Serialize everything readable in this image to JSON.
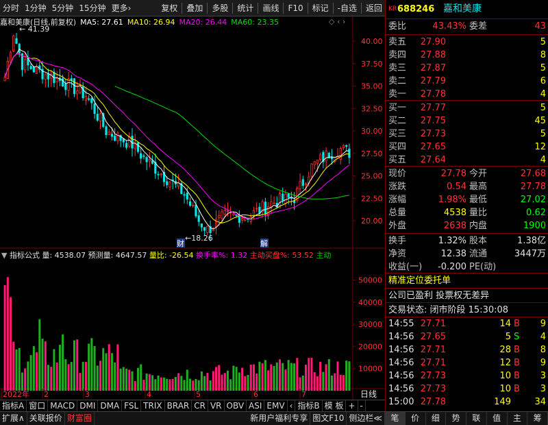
{
  "toolbar": {
    "left": [
      "分时",
      "1分钟",
      "5分钟",
      "15分钟",
      "更多›"
    ],
    "right": [
      "复权",
      "叠加",
      "多股",
      "统计",
      "画线",
      "F10",
      "标记",
      "-自选",
      "返回"
    ]
  },
  "chart": {
    "title": "嘉和美康(日线,前复权)",
    "ma5": "MA5: 27.61",
    "ma10": "MA10: 26.94",
    "ma20": "MA20: 26.44",
    "ma60": "MA60: 23.35",
    "high_label": "41.39",
    "low_label": "18.26",
    "marker_cai": "财",
    "marker_jie": "解",
    "price_ticks": [
      "40.00",
      "37.50",
      "35.00",
      "32.50",
      "30.00",
      "27.50",
      "25.00",
      "22.50",
      "20.00"
    ],
    "price_tick_values": [
      40,
      37.5,
      35,
      32.5,
      30,
      27.5,
      25,
      22.5,
      20
    ],
    "colors": {
      "up": "#ff3232",
      "down": "#00e6e6",
      "ma5": "#ffffff",
      "ma10": "#ffff00",
      "ma20": "#ff00ff",
      "ma60": "#00dd00"
    }
  },
  "indicator": {
    "label": "指标公式",
    "vol": "量: 4538.07",
    "pred": "预测量: 4647.57",
    "liangbi": "量比: -26.54",
    "huanshou": "换手率%: 1.32",
    "zhudong": "主动买盘%: 53.52",
    "zhudong2": "主动",
    "vol_ticks": [
      "50000",
      "40000",
      "30000",
      "20000",
      "10000"
    ],
    "vol_tick_values": [
      50000,
      40000,
      30000,
      20000,
      10000
    ]
  },
  "xaxis": {
    "labels": [
      "2022年",
      "2",
      "3",
      "4",
      "5",
      "6",
      "7"
    ],
    "period": "日线"
  },
  "tabs_a": [
    "指标A",
    "窗口",
    "MACD",
    "DMI",
    "DMA",
    "FSL",
    "TRIX",
    "BRAR",
    "CR",
    "VR",
    "OBV",
    "ASI",
    "EMV",
    "‹",
    "指标B",
    "模 板",
    "+",
    "-"
  ],
  "tabs_b": [
    "扩展∧",
    "关联报价",
    "财富圈",
    "新用户福利专享",
    "图文F10",
    "侧边栏≪"
  ],
  "panel": {
    "kr": "KR",
    "code": "688246",
    "name": "嘉和美康",
    "weibi_label": "委比",
    "weibi": "43.43%",
    "weicha_label": "委差",
    "weicha": "43",
    "asks": [
      {
        "label": "卖五",
        "price": "27.90",
        "vol": "5"
      },
      {
        "label": "卖四",
        "price": "27.88",
        "vol": "8"
      },
      {
        "label": "卖三",
        "price": "27.87",
        "vol": "5"
      },
      {
        "label": "卖二",
        "price": "27.79",
        "vol": "6"
      },
      {
        "label": "卖一",
        "price": "27.78",
        "vol": "4"
      }
    ],
    "bids": [
      {
        "label": "买一",
        "price": "27.77",
        "vol": "5"
      },
      {
        "label": "买二",
        "price": "27.75",
        "vol": "45"
      },
      {
        "label": "买三",
        "price": "27.73",
        "vol": "5"
      },
      {
        "label": "买四",
        "price": "27.65",
        "vol": "12"
      },
      {
        "label": "买五",
        "price": "27.64",
        "vol": "4"
      }
    ],
    "stats": [
      {
        "l1": "现价",
        "v1": "27.78",
        "c1": "#ff3232",
        "l2": "今开",
        "v2": "27.68",
        "c2": "#ff3232"
      },
      {
        "l1": "涨跌",
        "v1": "0.54",
        "c1": "#ff3232",
        "l2": "最高",
        "v2": "27.78",
        "c2": "#ff3232"
      },
      {
        "l1": "涨幅",
        "v1": "1.98%",
        "c1": "#ff3232",
        "l2": "最低",
        "v2": "27.02",
        "c2": "#00ff00"
      },
      {
        "l1": "总量",
        "v1": "4538",
        "c1": "#ffff00",
        "l2": "量比",
        "v2": "0.62",
        "c2": "#00ff00"
      },
      {
        "l1": "外盘",
        "v1": "2638",
        "c1": "#ff3232",
        "l2": "内盘",
        "v2": "1900",
        "c2": "#00ff00"
      }
    ],
    "stats2": [
      {
        "l1": "换手",
        "v1": "1.32%",
        "l2": "股本",
        "v2": "1.38亿"
      },
      {
        "l1": "净资",
        "v1": "12.38",
        "l2": "流通",
        "v2": "3447万"
      },
      {
        "l1": "收益(一)",
        "v1": "-0.200",
        "l2": "PE(动)",
        "v2": ""
      }
    ],
    "banner": "精准定位委托单",
    "info": "公司已盈利 投票权无差异",
    "status": "交易状态: 闭市阶段 15:30:08",
    "trades": [
      {
        "t": "14:55",
        "p": "27.71",
        "v": "14",
        "s": "B"
      },
      {
        "t": "14:56",
        "p": "27.65",
        "v": "5",
        "s": "S"
      },
      {
        "t": "14:56",
        "p": "27.71",
        "v": "28",
        "s": "B"
      },
      {
        "t": "14:56",
        "p": "27.71",
        "v": "12",
        "s": "B"
      },
      {
        "t": "14:56",
        "p": "27.73",
        "v": "10",
        "s": "B"
      },
      {
        "t": "14:56",
        "p": "27.73",
        "v": "10",
        "s": "B"
      },
      {
        "t": "15:00",
        "p": "27.78",
        "v": "149",
        "s": ""
      }
    ],
    "trade_extra": [
      "9",
      "4",
      "8",
      "9",
      "3",
      "3",
      "34"
    ],
    "tabs": [
      "笔",
      "价",
      "细",
      "势",
      "联",
      "值",
      "主",
      "筹"
    ]
  }
}
